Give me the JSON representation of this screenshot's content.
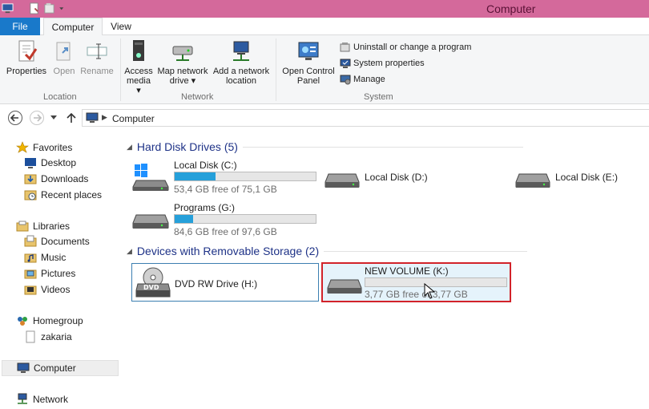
{
  "window": {
    "title": "Computer"
  },
  "ribbon_tabs": {
    "file": "File",
    "computer": "Computer",
    "view": "View"
  },
  "ribbon": {
    "location": {
      "label": "Location",
      "properties": "Properties",
      "open": "Open",
      "rename": "Rename"
    },
    "network": {
      "label": "Network",
      "access_media": [
        "Access",
        "media ▾"
      ],
      "map_drive": [
        "Map network",
        "drive ▾"
      ],
      "add_location": [
        "Add a network",
        "location"
      ]
    },
    "system": {
      "label": "System",
      "control_panel": [
        "Open Control",
        "Panel"
      ],
      "uninstall": "Uninstall or change a program",
      "system_properties": "System properties",
      "manage": "Manage"
    }
  },
  "address": {
    "breadcrumb": "Computer"
  },
  "sidebar": {
    "favorites": "Favorites",
    "desktop": "Desktop",
    "downloads": "Downloads",
    "recent": "Recent places",
    "libraries": "Libraries",
    "documents": "Documents",
    "music": "Music",
    "pictures": "Pictures",
    "videos": "Videos",
    "homegroup": "Homegroup",
    "user": "zakaria",
    "computer": "Computer",
    "network": "Network"
  },
  "content": {
    "hdd_group": "Hard Disk Drives (5)",
    "removable_group": "Devices with Removable Storage (2)",
    "drives": {
      "c": {
        "name": "Local Disk (C:)",
        "free": "53,4 GB free of 75,1 GB",
        "used_fraction": 0.29
      },
      "d": {
        "name": "Local Disk (D:)"
      },
      "e": {
        "name": "Local Disk (E:)"
      },
      "g": {
        "name": "Programs (G:)",
        "free": "84,6 GB free of 97,6 GB",
        "used_fraction": 0.13
      },
      "h": {
        "name": "DVD RW Drive (H:)",
        "dvd_badge": "DVD"
      },
      "k": {
        "name": "NEW VOLUME (K:)",
        "free": "3,77 GB free of 3,77 GB",
        "used_fraction": 0.0
      }
    }
  },
  "colors": {
    "titlebar": "#d4699b",
    "file_tab": "#1979ca",
    "bar_fill": "#26a0da",
    "highlight": "#d2232a"
  }
}
